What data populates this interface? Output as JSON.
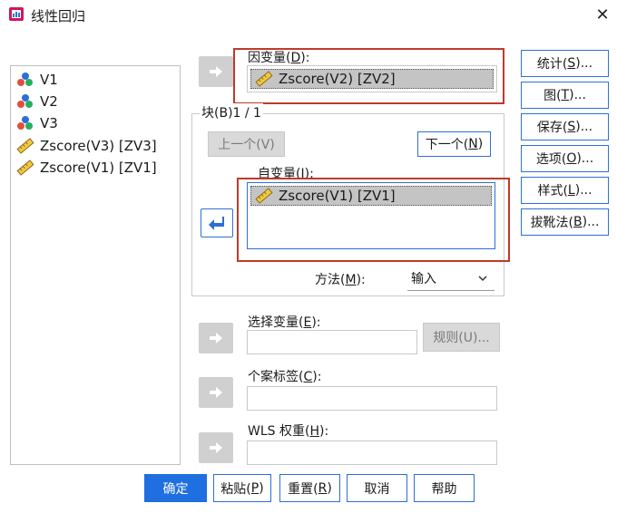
{
  "window": {
    "title": "线性回归",
    "close_glyph": "✕"
  },
  "variables": [
    {
      "label": "V1",
      "icon": "scale-nominal-icon"
    },
    {
      "label": "V2",
      "icon": "scale-nominal-icon"
    },
    {
      "label": "V3",
      "icon": "scale-nominal-icon"
    },
    {
      "label": "Zscore(V3) [ZV3]",
      "icon": "ruler-scale-icon"
    },
    {
      "label": "Zscore(V1) [ZV1]",
      "icon": "ruler-scale-icon"
    }
  ],
  "dependent": {
    "label_pre": "因变量(",
    "label_key": "D",
    "label_post": "):",
    "value": "Zscore(V2) [ZV2]"
  },
  "block": {
    "label": "块(B)1 / 1",
    "prev_label": "上一个(V)",
    "next_label_pre": "下一个(",
    "next_label_key": "N",
    "next_label_post": ")"
  },
  "independent": {
    "label_pre": "自变量(",
    "label_key": "I",
    "label_post": "):",
    "value": "Zscore(V1) [ZV1]"
  },
  "method": {
    "label_pre": "方法(",
    "label_key": "M",
    "label_post": "):",
    "value": "输入"
  },
  "selection": {
    "label_pre": "选择变量(",
    "label_key": "E",
    "label_post": "):",
    "rule_label": "规则(U)..."
  },
  "case_labels": {
    "label_pre": "个案标签(",
    "label_key": "C",
    "label_post": "):"
  },
  "wls": {
    "label_pre": "WLS 权重(",
    "label_key": "H",
    "label_post": "):"
  },
  "side_buttons": [
    {
      "pre": "统计(",
      "key": "S",
      "post": ")..."
    },
    {
      "pre": "图(",
      "key": "T",
      "post": ")..."
    },
    {
      "pre": "保存(",
      "key": "S",
      "post": ")..."
    },
    {
      "pre": "选项(",
      "key": "O",
      "post": ")..."
    },
    {
      "pre": "样式(",
      "key": "L",
      "post": ")..."
    },
    {
      "pre": "拔靴法(",
      "key": "B",
      "post": ")..."
    }
  ],
  "bottom_buttons": {
    "ok": "确定",
    "paste_pre": "粘贴(",
    "paste_key": "P",
    "paste_post": ")",
    "reset_pre": "重置(",
    "reset_key": "R",
    "reset_post": ")",
    "cancel": "取消",
    "help": "帮助"
  },
  "colors": {
    "accent": "#2c6fd6",
    "primary_button": "#1f6fe0",
    "highlight_frame": "#c0392b",
    "selection_fill": "#c4c4c4"
  }
}
